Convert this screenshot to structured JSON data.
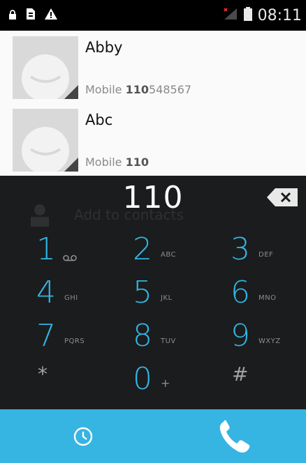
{
  "status_bar": {
    "left_icons": [
      "lock-icon",
      "sim-card-icon",
      "warning-icon"
    ],
    "right_icons": [
      "signal-no-service-icon",
      "battery-icon"
    ],
    "time": "08:11"
  },
  "contacts": [
    {
      "name": "Abby",
      "phone_label": "Mobile",
      "phone_match": "110",
      "phone_rest": "548567"
    },
    {
      "name": "Abc",
      "phone_label": "Mobile",
      "phone_match": "110",
      "phone_rest": ""
    }
  ],
  "dialer": {
    "input_value": "110",
    "ghost_action": "Add to contacts",
    "keys": [
      {
        "num": "1",
        "letters": ""
      },
      {
        "num": "2",
        "letters": "ABC"
      },
      {
        "num": "3",
        "letters": "DEF"
      },
      {
        "num": "4",
        "letters": "GHI"
      },
      {
        "num": "5",
        "letters": "JKL"
      },
      {
        "num": "6",
        "letters": "MNO"
      },
      {
        "num": "7",
        "letters": "PQRS"
      },
      {
        "num": "8",
        "letters": "TUV"
      },
      {
        "num": "9",
        "letters": "WXYZ"
      }
    ],
    "star": "*",
    "zero": "0",
    "zero_sub": "+",
    "hash": "#"
  },
  "bottom_bar": {
    "left_icon": "clock-history-icon",
    "right_icon": "phone-call-icon"
  },
  "colors": {
    "accent": "#33b5e5",
    "bottom_bar": "#36b4e2",
    "dialer_bg": "#1b1c1d",
    "list_bg": "#fafafa"
  }
}
